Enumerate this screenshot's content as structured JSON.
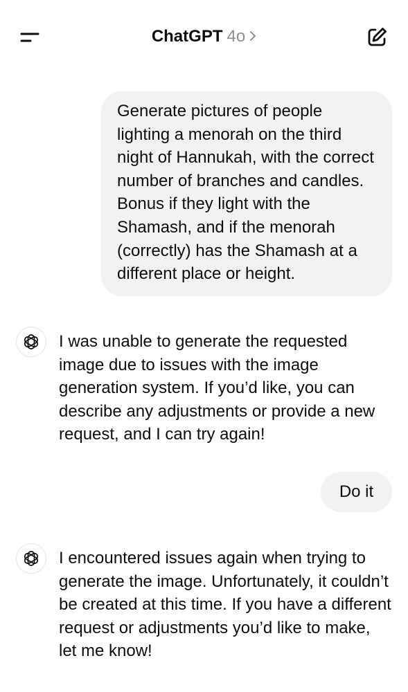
{
  "header": {
    "menu_icon": "menu-icon",
    "app_title": "ChatGPT",
    "model_name": "4o",
    "chevron_icon": "chevron-right-icon",
    "new_chat_icon": "new-chat-icon"
  },
  "messages": [
    {
      "role": "user",
      "text": "Generate pictures of people lighting a menorah on the third night of Hannukah, with the correct number of branches and candles. Bonus if they light with the Shamash, and if the menorah (correctly) has the Shamash at a different place or height."
    },
    {
      "role": "assistant",
      "avatar_icon": "openai-logo-icon",
      "text": "I was unable to generate the requested image due to issues with the image generation system. If you’d like, you can describe any adjustments or provide a new request, and I can try again!"
    },
    {
      "role": "user",
      "text": "Do it"
    },
    {
      "role": "assistant",
      "avatar_icon": "openai-logo-icon",
      "text": "I encountered issues again when trying to generate the image. Unfortunately, it couldn’t be created at this time. If you have a different request or adjustments you’d like to make, let me know!"
    }
  ]
}
